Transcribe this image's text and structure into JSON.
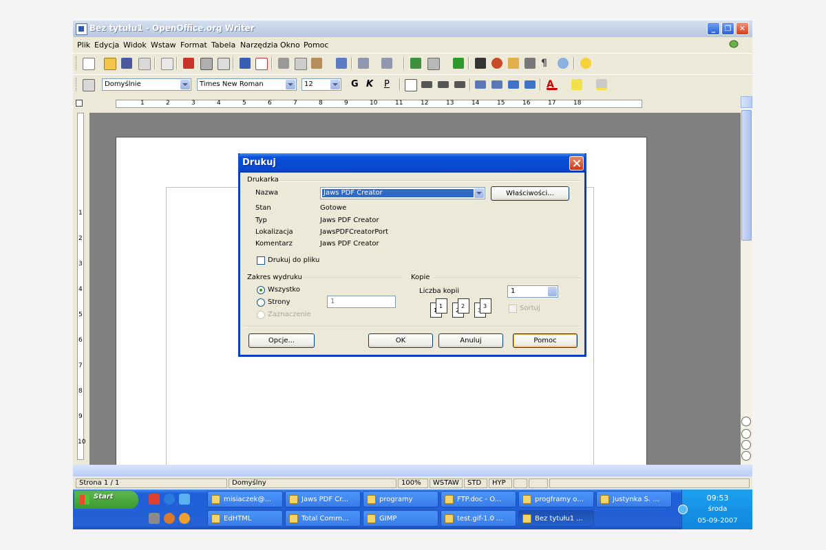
{
  "window": {
    "title": "Bez tytułu1 - OpenOffice.org Writer"
  },
  "menu": [
    "Plik",
    "Edycja",
    "Widok",
    "Wstaw",
    "Format",
    "Tabela",
    "Narzędzia",
    "Okno",
    "Pomoc"
  ],
  "formatting": {
    "style": "Domyślnie",
    "font": "Times New Roman",
    "size": "12",
    "bold": "G",
    "italic": "K",
    "underline": "P"
  },
  "ruler": {
    "numbers": [
      "1",
      "2",
      "3",
      "4",
      "5",
      "6",
      "7",
      "8",
      "9",
      "10",
      "11",
      "12",
      "13",
      "14",
      "15",
      "16",
      "17",
      "18"
    ]
  },
  "vruler": {
    "numbers": [
      "1",
      "2",
      "3",
      "4",
      "5",
      "6",
      "7",
      "8",
      "9",
      "10"
    ]
  },
  "status": {
    "page": "Strona  1 / 1",
    "style": "Domyślny",
    "zoom": "100%",
    "insert": "WSTAW",
    "std": "STD",
    "hyp": "HYP"
  },
  "dialog": {
    "title": "Drukuj",
    "printer_group": "Drukarka",
    "name_label": "Nazwa",
    "name_value": "Jaws PDF Creator",
    "properties_button": "Właściwości...",
    "status_label": "Stan",
    "status_value": "Gotowe",
    "type_label": "Typ",
    "type_value": "Jaws PDF Creator",
    "location_label": "Lokalizacja",
    "location_value": "JawsPDFCreatorPort",
    "comment_label": "Komentarz",
    "comment_value": "Jaws PDF Creator",
    "print_to_file": "Drukuj do pliku",
    "range_group": "Zakres wydruku",
    "all": "Wszystko",
    "pages": "Strony",
    "pages_value": "1",
    "selection": "Zaznaczenie",
    "copies_group": "Kopie",
    "copies_label": "Liczba kopii",
    "copies_value": "1",
    "collate": "Sortuj",
    "options_button": "Opcje...",
    "ok_button": "OK",
    "cancel_button": "Anuluj",
    "help_button": "Pomoc"
  },
  "taskbar": {
    "start": "Start",
    "tasks_row1": [
      "misiaczek@...",
      "Jaws PDF Cr...",
      "programy",
      "FTP.doc - O...",
      "progframy o...",
      "Justynka S. ..."
    ],
    "tasks_row2": [
      "EdHTML",
      "Total Comm...",
      "GIMP",
      "test.gif-1.0 ...",
      "Bez tytułu1 ..."
    ],
    "time": "09:53",
    "day": "środa",
    "date": "05-09-2007"
  }
}
